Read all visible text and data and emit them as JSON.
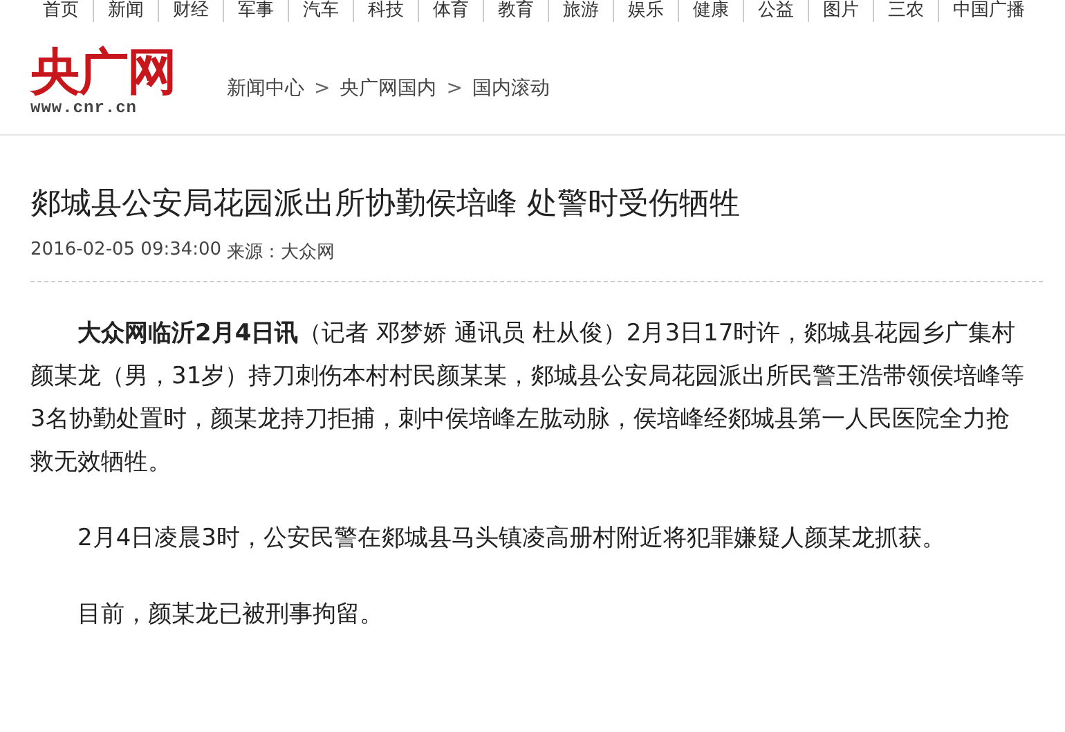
{
  "top_nav": [
    "首页",
    "新闻",
    "财经",
    "军事",
    "汽车",
    "科技",
    "体育",
    "教育",
    "旅游",
    "娱乐",
    "健康",
    "公益",
    "图片",
    "三农",
    "中国广播"
  ],
  "logo": {
    "name": "央广网",
    "domain": "www.cnr.cn"
  },
  "breadcrumb": {
    "separator": ">",
    "items": [
      "新闻中心",
      "央广网国内",
      "国内滚动"
    ]
  },
  "article": {
    "title": "郯城县公安局花园派出所协勤侯培峰 处警时受伤牺牲",
    "date": "2016-02-05 09:34:00",
    "source_label": "来源：",
    "source": "大众网",
    "paragraphs": [
      "**大众网临沂2月4日讯**（记者 邓梦娇 通讯员 杜从俊）2月3日17时许，郯城县花园乡广集村颜某龙（男，31岁）持刀刺伤本村村民颜某某，郯城县公安局花园派出所民警王浩带领侯培峰等3名协勤处置时，颜某龙持刀拒捕，刺中侯培峰左肱动脉，侯培峰经郯城县第一人民医院全力抢救无效牺牲。",
      "2月4日凌晨3时，公安民警在郯城县马头镇凌高册村附近将犯罪嫌疑人颜某龙抓获。",
      "目前，颜某龙已被刑事拘留。"
    ]
  }
}
